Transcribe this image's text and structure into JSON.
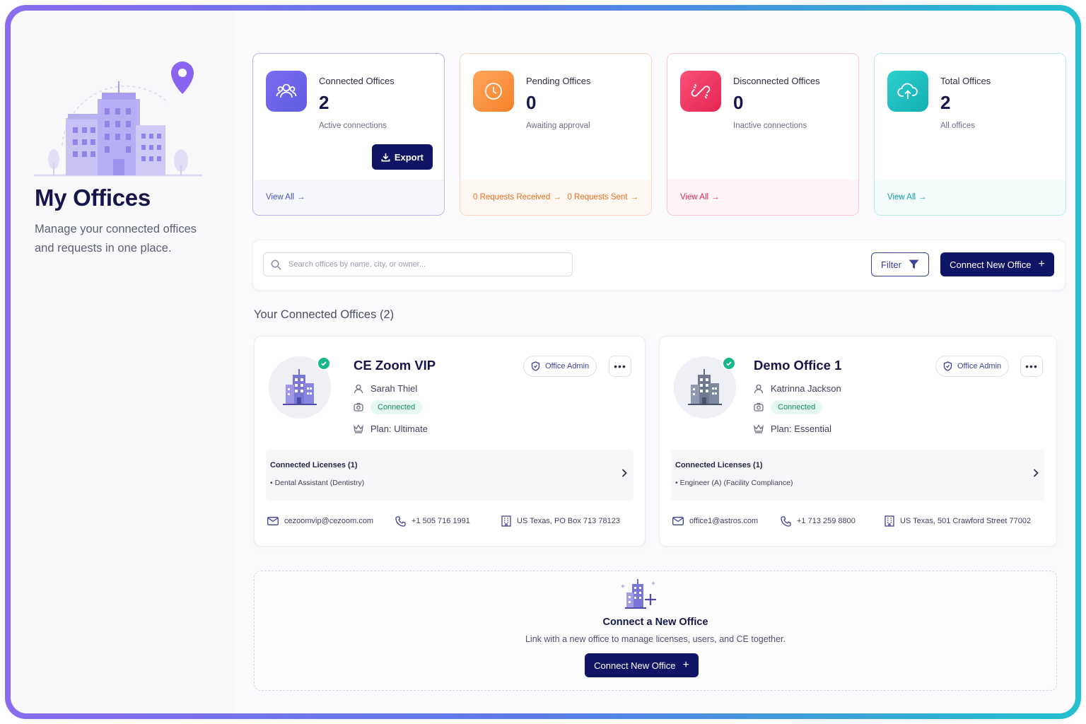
{
  "header": {
    "title": "My Offices",
    "subtitle": "Manage your connected offices and requests in one place."
  },
  "stats": [
    {
      "label": "Connected Offices",
      "value": "2",
      "desc": "Active connections",
      "icon": "users-icon",
      "accent": "#6c5ce7",
      "link": "View All"
    },
    {
      "label": "Pending Offices",
      "value": "0",
      "desc": "Awaiting approval",
      "icon": "clock-icon",
      "accent": "#f5812b",
      "links": [
        "0 Requests Received",
        "0 Requests Sent"
      ]
    },
    {
      "label": "Disconnected Offices",
      "value": "0",
      "desc": "Inactive connections",
      "icon": "broken-link-icon",
      "accent": "#ec2d5a",
      "link": "View All"
    },
    {
      "label": "Total Offices",
      "value": "2",
      "desc": "All offices",
      "icon": "cloud-upload-icon",
      "accent": "#14b8b8",
      "link": "View All"
    }
  ],
  "export_label": "Export",
  "toolbar": {
    "search_placeholder": "Search offices by name, city, or owner...",
    "filter_label": "Filter",
    "connect_label": "Connect New Office"
  },
  "section_title": "Your Connected Offices (2)",
  "offices": [
    {
      "name": "CE Zoom VIP",
      "owner": "Sarah Thiel",
      "status": "Connected",
      "plan": "Plan: Ultimate",
      "role": "Office Admin",
      "licenses_title": "Connected Licenses (1)",
      "licenses": [
        "• Dental Assistant (Dentistry)"
      ],
      "email": "cezoomvip@cezoom.com",
      "phone": "+1 505 716 1991",
      "address": "US Texas, PO Box 713 78123"
    },
    {
      "name": "Demo Office 1",
      "owner": "Katrinna Jackson",
      "status": "Connected",
      "plan": "Plan: Essential",
      "role": "Office Admin",
      "licenses_title": "Connected Licenses (1)",
      "licenses": [
        "• Engineer (A) (Facility Compliance)"
      ],
      "email": "office1@astros.com",
      "phone": "+1 713 259 8800",
      "address": "US Texas, 501 Crawford Street 77002"
    }
  ],
  "connect_new": {
    "title": "Connect a New Office",
    "desc": "Link with a new office to manage licenses, users, and CE together.",
    "button": "Connect New Office"
  },
  "colors": {
    "navy": "#0f1464",
    "connected_green": "#19b58b"
  }
}
